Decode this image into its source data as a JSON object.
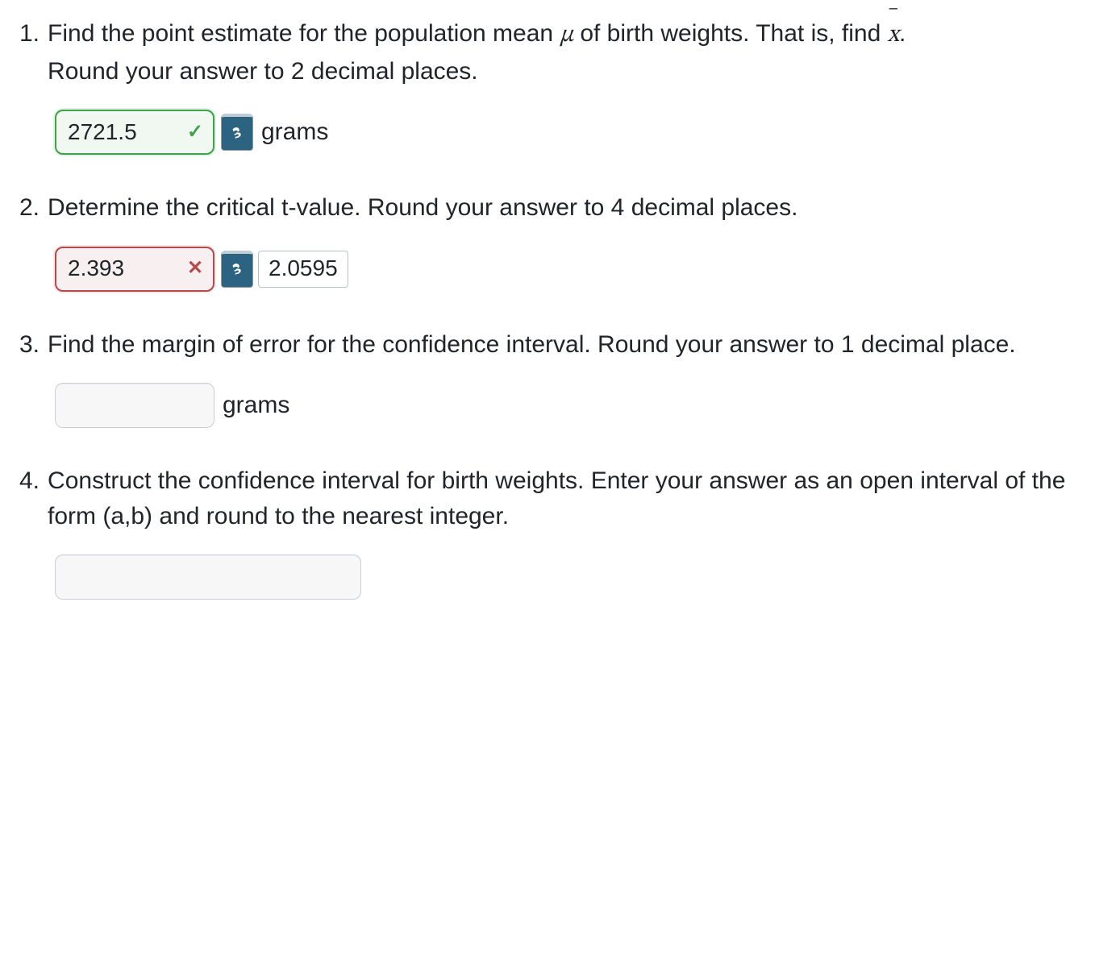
{
  "q1": {
    "number": "1.",
    "text_a": "Find the point estimate for the population mean ",
    "mu": "μ",
    "text_b": " of birth weights. That is, find ",
    "xbar": "x",
    "text_c": ".",
    "text_line2": "Round your answer to 2 decimal places.",
    "answer_value": "2721.5",
    "status": "correct",
    "unit": "grams"
  },
  "q2": {
    "number": "2.",
    "text": "Determine the critical t-value. Round your answer to 4 decimal places.",
    "answer_value": "2.393",
    "status": "incorrect",
    "correct_value": "2.0595"
  },
  "q3": {
    "number": "3.",
    "text": "Find the margin of error for the confidence interval. Round your answer to 1 decimal place.",
    "answer_value": "",
    "unit": "grams"
  },
  "q4": {
    "number": "4.",
    "text": "Construct the confidence interval for birth weights. Enter your answer as an open interval of the form (a,b) and round to the nearest integer.",
    "answer_value": ""
  },
  "icons": {
    "check": "✓",
    "cross": "✕",
    "script": "σ ̷"
  }
}
